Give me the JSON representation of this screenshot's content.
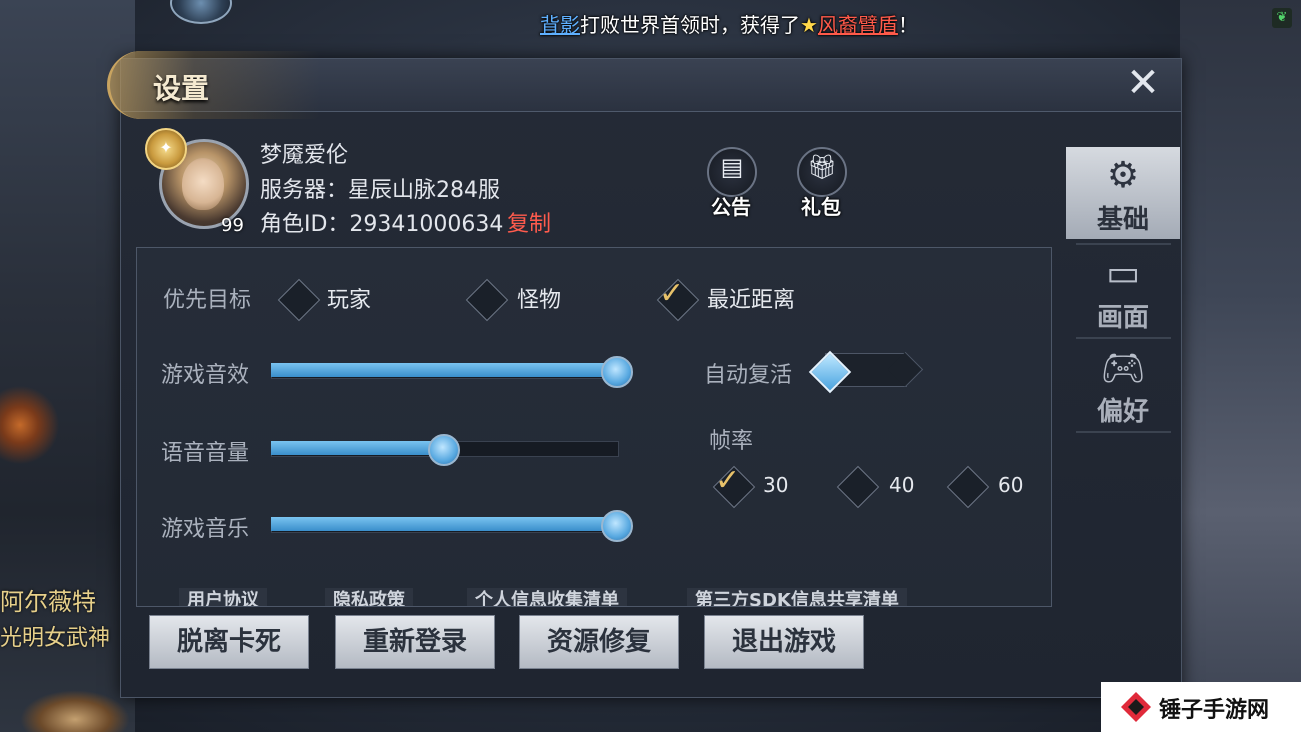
{
  "announcement": {
    "player": "背影",
    "text_before_item": "打败世界首领时，获得了",
    "item": "风裔臂盾",
    "end": "！"
  },
  "background": {
    "side_text_1": "阿尔薇特",
    "side_text_2": "光明女武神"
  },
  "dialog": {
    "title": "设置",
    "close_label": "✕"
  },
  "profile": {
    "name": "梦魇爱伦",
    "server": "服务器：星辰山脉284服",
    "role_id": "角色ID：29341000634",
    "copy_label": "复制",
    "level": "99"
  },
  "quick_buttons": {
    "notice_label": "公告",
    "gift_label": "礼包"
  },
  "tabs": [
    {
      "label": "基础",
      "icon": "gear-icon",
      "active": true
    },
    {
      "label": "画面",
      "icon": "monitor-icon",
      "active": false
    },
    {
      "label": "偏好",
      "icon": "gamepad-icon",
      "active": false
    }
  ],
  "settings": {
    "priority_target": {
      "label": "优先目标",
      "options": [
        "玩家",
        "怪物",
        "最近距离"
      ],
      "selected": "最近距离"
    },
    "game_sfx": {
      "label": "游戏音效",
      "value": 1.0
    },
    "voice_volume": {
      "label": "语音音量",
      "value": 0.5
    },
    "game_music": {
      "label": "游戏音乐",
      "value": 1.0
    },
    "auto_revive": {
      "label": "自动复活",
      "enabled": false
    },
    "frame_rate": {
      "label": "帧率",
      "options": [
        "30",
        "40",
        "60"
      ],
      "selected": "30"
    }
  },
  "links": [
    "用户协议",
    "隐私政策",
    "个人信息收集清单",
    "第三方SDK信息共享清单"
  ],
  "actions": {
    "unstuck_label": "脱离卡死",
    "relogin_label": "重新登录",
    "repair_label": "资源修复",
    "exit_label": "退出游戏"
  },
  "watermark": {
    "text": "锤子手游网"
  },
  "colors": {
    "accent_blue": "#3a8ecb",
    "check_gold": "#e7c16a",
    "copy_red": "#ff5b4d",
    "announce_name": "#5fb0ff",
    "announce_item": "#ff5a4a"
  }
}
